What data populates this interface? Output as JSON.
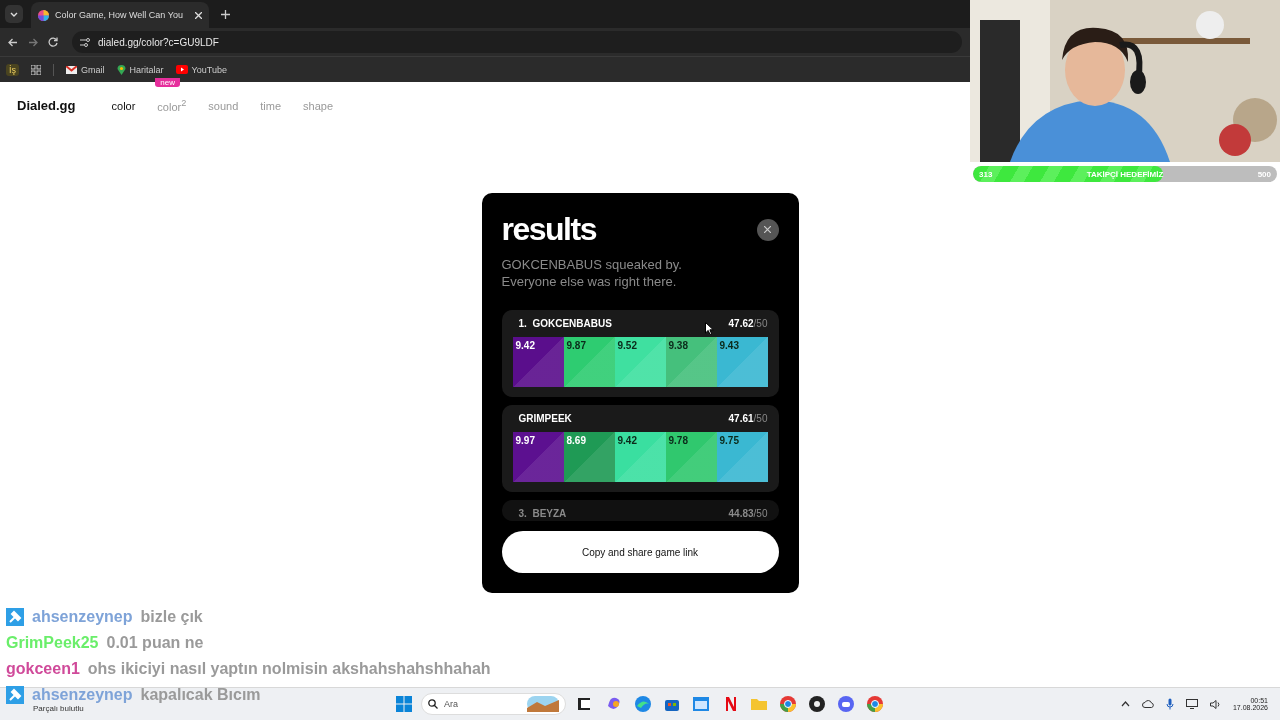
{
  "browser": {
    "tabs": [
      {
        "title": "Color Game, How Well Can You",
        "selected": true
      }
    ],
    "url": "dialed.gg/color?c=GU9LDF",
    "bookmarks": [
      {
        "kind": "profile",
        "label": "İş"
      },
      {
        "kind": "apps"
      },
      {
        "kind": "mail",
        "label": "Gmail"
      },
      {
        "kind": "maps",
        "label": "Haritalar"
      },
      {
        "kind": "video",
        "label": "YouTube"
      }
    ]
  },
  "site": {
    "logo": "Dialed.gg",
    "nav": [
      {
        "label": "color",
        "selected": true
      },
      {
        "label": "color$^{2}$",
        "selected": false,
        "badge": "new"
      },
      {
        "label": "sound",
        "selected": false
      },
      {
        "label": "time",
        "selected": false
      },
      {
        "label": "shape",
        "selected": false
      }
    ]
  },
  "results": {
    "title": "results",
    "subtitle": "GOKCENBABUS squeaked by.\nEveryone else was right there.",
    "players": [
      {
        "rank": "1.",
        "name": "GOKCENBABUS",
        "score": "47.62",
        "max": "/50",
        "faded": false,
        "scores": [
          {
            "value": "9.42",
            "color": "#5a0e8c"
          },
          {
            "value": "9.87",
            "color": "#2ecc71"
          },
          {
            "value": "9.52",
            "color": "#3fe0a0"
          },
          {
            "value": "9.38",
            "color": "#45c07c"
          },
          {
            "value": "9.43",
            "color": "#3ab8d2"
          }
        ]
      },
      {
        "name": "GRIMPEEK",
        "score": "47.61",
        "max": "/50",
        "faded": false,
        "scores": [
          {
            "value": "9.97",
            "color": "#5c1090"
          },
          {
            "value": "8.69",
            "color": "#1f9a55"
          },
          {
            "value": "9.42",
            "color": "#3adfa0"
          },
          {
            "value": "9.78",
            "color": "#30c86e"
          },
          {
            "value": "9.75",
            "color": "#3ab8d2"
          }
        ]
      },
      {
        "rank": "3.",
        "name": "BEYZA",
        "score": "44.83",
        "max": "/50",
        "faded": true
      }
    ],
    "button": "Copy and share game link"
  },
  "stream": {
    "goal": {
      "current": "313",
      "label": "TAKİPÇİ HEDEFİMİZ",
      "target": "500",
      "level": 0.626
    },
    "chat": [
      {
        "user": "ahsenzeynep",
        "color": "#7ea3d8",
        "moderator": true,
        "message": "bizle çık"
      },
      {
        "user": "GrimPeek25",
        "color": "#6aee6a",
        "moderator": false,
        "message": "0.01 puan ne"
      },
      {
        "user": "gokceen1",
        "color": "#d04a9a",
        "moderator": false,
        "message": "ohs ikiciyi nasıl yaptın nolmisin akshahshahshhahah"
      },
      {
        "user": "ahsenzeynep",
        "color": "#7ea3d8",
        "moderator": true,
        "message": "kapalıcak Bıcım"
      }
    ]
  },
  "taskbar": {
    "weather": "Parçalı bulutlu",
    "search": "Ara",
    "apps": [
      {
        "kind": "taskview"
      },
      {
        "kind": "swirl"
      },
      {
        "kind": "wave"
      },
      {
        "kind": "store"
      },
      {
        "kind": "window"
      },
      {
        "kind": "letter"
      },
      {
        "kind": "folder"
      },
      {
        "kind": "chrome"
      },
      {
        "kind": "dark"
      },
      {
        "kind": "chat"
      },
      {
        "kind": "chrome"
      }
    ],
    "time": "00:51",
    "date": "17.08.2026"
  }
}
